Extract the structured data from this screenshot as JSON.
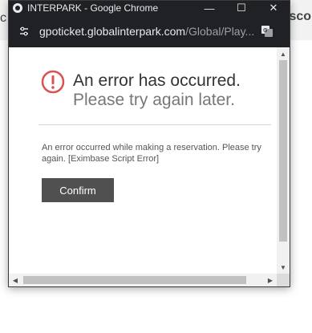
{
  "background": {
    "left_text": "c",
    "right_text": "isco"
  },
  "window": {
    "title": "INTERPARK - Google Chrome",
    "controls": {
      "minimize": "—",
      "maximize": "☐",
      "close": "✕"
    }
  },
  "address_bar": {
    "domain": "gpoticket.globalinterpark.com",
    "path": "/Global/Play..."
  },
  "dialog": {
    "title": "An error has occurred.",
    "subtitle": "Please try again later.",
    "message": "An error occurred while making a reservation. Please try again. [Eximbase Script Error]",
    "confirm_label": "Confirm"
  },
  "colors": {
    "titlebar": "#202124",
    "error_icon": "#d9534f",
    "button": "#505050"
  }
}
